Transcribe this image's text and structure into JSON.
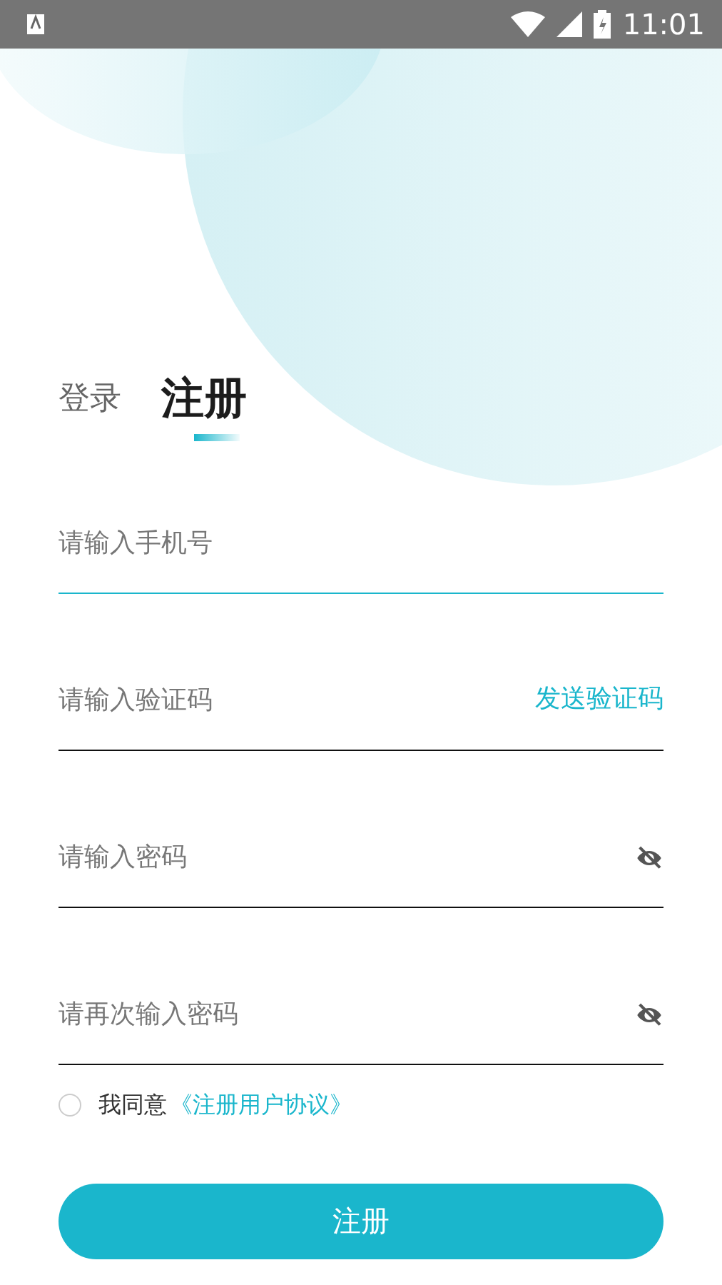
{
  "status_bar": {
    "time": "11:01"
  },
  "tabs": [
    {
      "label": "登录",
      "selected": false
    },
    {
      "label": "注册",
      "selected": true
    }
  ],
  "fields": [
    {
      "kind": "phone",
      "placeholder": "请输入手机号",
      "focused": true
    },
    {
      "kind": "code",
      "placeholder": "请输入验证码",
      "focused": false,
      "action": "发送验证码"
    },
    {
      "kind": "password",
      "placeholder": "请输入密码",
      "focused": false
    },
    {
      "kind": "password",
      "placeholder": "请再次输入密码",
      "focused": false
    }
  ],
  "agreement": {
    "checked": false,
    "text": "我同意",
    "link": "《注册用户协议》"
  },
  "submit": "注册"
}
